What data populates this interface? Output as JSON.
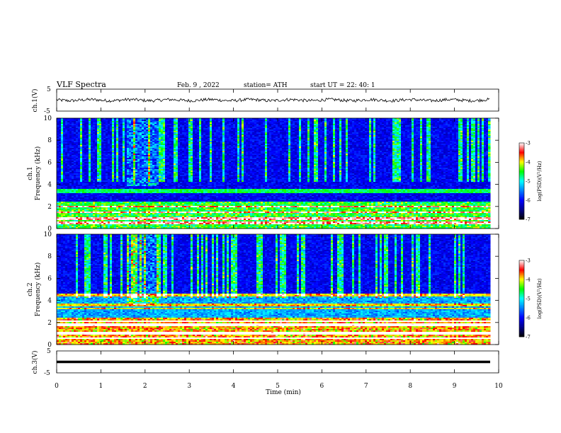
{
  "header": {
    "title": "VLF  Spectra",
    "date": "Feb. 9  , 2022",
    "station": "station= ATH",
    "start": "start  UT  =    22: 40: 1"
  },
  "chart_data": [
    {
      "type": "line",
      "ylabel": "ch.1(V)",
      "ylim": [
        -5,
        5
      ],
      "yticks": [
        "5",
        "-5"
      ],
      "signal": "noise around ~0 V"
    },
    {
      "type": "heatmap",
      "ylabel_channel": "ch.1",
      "ylabel": "Frequency  (kHz)",
      "ylim": [
        0,
        10
      ],
      "yticks": [
        "0",
        "2",
        "4",
        "6",
        "8",
        "10"
      ],
      "colorbar": {
        "label": "log(PSD)(V²/Hz)",
        "ticks": [
          "-3",
          "-4",
          "-5",
          "-6",
          "-7"
        ],
        "range": [
          -7,
          -3
        ]
      }
    },
    {
      "type": "heatmap",
      "ylabel_channel": "ch.2",
      "ylabel": "Frequency  (kHz)",
      "ylim": [
        0,
        10
      ],
      "yticks": [
        "0",
        "2",
        "4",
        "6",
        "8",
        "10"
      ],
      "colorbar": {
        "label": "log(PSD)(V²/Hz)",
        "ticks": [
          "-3",
          "-4",
          "-5",
          "-6",
          "-7"
        ],
        "range": [
          -7,
          -3
        ]
      }
    },
    {
      "type": "line",
      "ylabel": "ch.3(V)",
      "ylim": [
        -5,
        5
      ],
      "yticks": [
        "5",
        "-5"
      ],
      "signal": "flat at ~0 V"
    }
  ],
  "xaxis": {
    "label": "Time  (min)",
    "xlim": [
      0,
      10
    ],
    "ticks": [
      "0",
      "1",
      "2",
      "3",
      "4",
      "5",
      "6",
      "7",
      "8",
      "9",
      "10"
    ]
  },
  "colors": {
    "colormap": [
      "#000000",
      "#00008a",
      "#0000ff",
      "#0080ff",
      "#00ffff",
      "#00ff00",
      "#ffff00",
      "#ff0000",
      "#ffffff"
    ]
  }
}
